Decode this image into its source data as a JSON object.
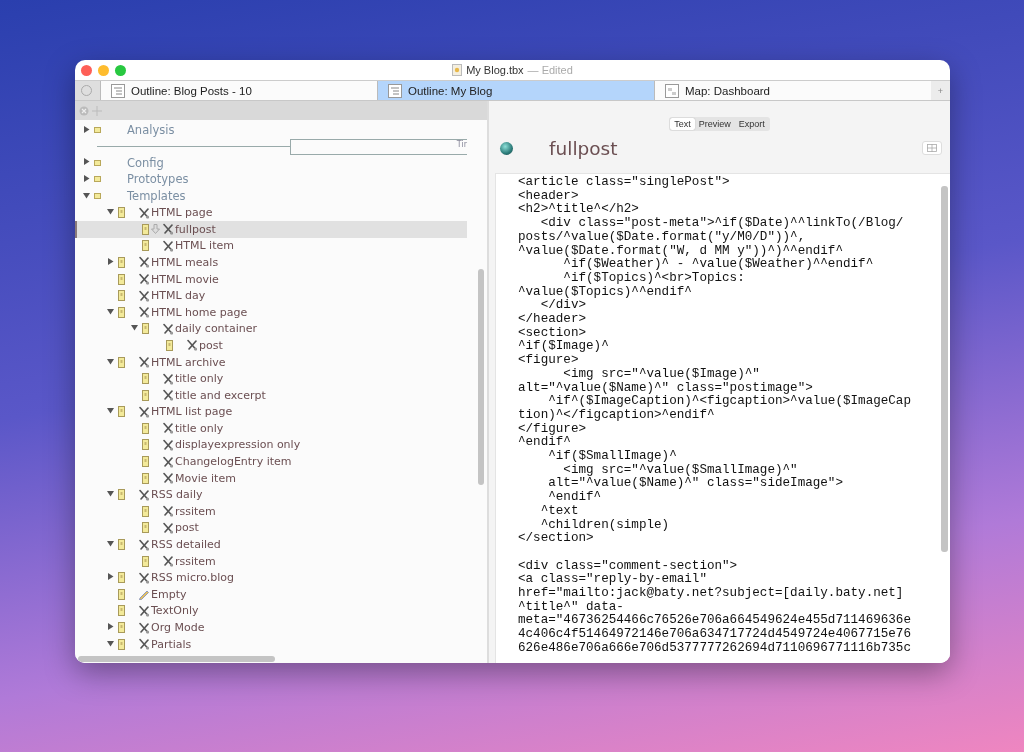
{
  "window": {
    "title": "My Blog.tbx",
    "status": "— Edited"
  },
  "tabs": [
    {
      "label": "Outline: Blog Posts - 10",
      "kind": "outline",
      "selected": false
    },
    {
      "label": "Outline: My Blog",
      "kind": "outline",
      "selected": true
    },
    {
      "label": "Map: Dashboard",
      "kind": "map",
      "selected": false
    }
  ],
  "new_tab_button": "+",
  "outline": {
    "timeline_label": "Tir",
    "items": [
      {
        "name": "Analysis",
        "kind": "container",
        "expanded": false,
        "selected": false
      },
      {
        "name": "Config",
        "kind": "container",
        "expanded": false,
        "selected": false
      },
      {
        "name": "Prototypes",
        "kind": "container",
        "expanded": false,
        "selected": false
      },
      {
        "name": "Templates",
        "kind": "container",
        "expanded": true,
        "selected": false,
        "children": [
          {
            "name": "HTML page",
            "kind": "template",
            "expanded": true,
            "selected": false,
            "children": [
              {
                "name": "fullpost",
                "kind": "template",
                "selected": true
              },
              {
                "name": "HTML item",
                "kind": "template",
                "selected": false
              }
            ]
          },
          {
            "name": "HTML meals",
            "kind": "template",
            "expanded": false,
            "selected": false
          },
          {
            "name": "HTML movie",
            "kind": "template",
            "selected": false
          },
          {
            "name": "HTML day",
            "kind": "template",
            "selected": false
          },
          {
            "name": "HTML home page",
            "kind": "template",
            "expanded": true,
            "selected": false,
            "children": [
              {
                "name": "daily container",
                "kind": "template",
                "expanded": true,
                "selected": false,
                "children": [
                  {
                    "name": "post",
                    "kind": "template",
                    "selected": false
                  }
                ]
              }
            ]
          },
          {
            "name": "HTML archive",
            "kind": "template",
            "expanded": true,
            "selected": false,
            "children": [
              {
                "name": "title only",
                "kind": "template",
                "selected": false
              },
              {
                "name": "title and excerpt",
                "kind": "template",
                "selected": false
              }
            ]
          },
          {
            "name": "HTML list page",
            "kind": "template",
            "expanded": true,
            "selected": false,
            "children": [
              {
                "name": "title only",
                "kind": "template",
                "selected": false
              },
              {
                "name": "displayexpression only",
                "kind": "template",
                "selected": false
              },
              {
                "name": "ChangelogEntry item",
                "kind": "template",
                "selected": false
              },
              {
                "name": "Movie item",
                "kind": "template",
                "selected": false
              }
            ]
          },
          {
            "name": "RSS daily",
            "kind": "template",
            "expanded": true,
            "selected": false,
            "children": [
              {
                "name": "rssitem",
                "kind": "template",
                "selected": false
              },
              {
                "name": "post",
                "kind": "template",
                "selected": false
              }
            ]
          },
          {
            "name": "RSS detailed",
            "kind": "template",
            "expanded": true,
            "selected": false,
            "children": [
              {
                "name": "rssitem",
                "kind": "template",
                "selected": false
              }
            ]
          },
          {
            "name": "RSS micro.blog",
            "kind": "template",
            "expanded": false,
            "selected": false
          },
          {
            "name": "Empty",
            "kind": "note",
            "selected": false
          },
          {
            "name": "TextOnly",
            "kind": "template",
            "selected": false
          },
          {
            "name": "Org Mode",
            "kind": "template",
            "expanded": false,
            "selected": false
          },
          {
            "name": "Partials",
            "kind": "template",
            "expanded": true,
            "selected": false
          }
        ]
      }
    ]
  },
  "editor": {
    "view_tabs": [
      {
        "label": "Text",
        "selected": true
      },
      {
        "label": "Preview",
        "selected": false
      },
      {
        "label": "Export",
        "selected": false
      }
    ],
    "note_title": "fullpost",
    "code_blocks": [
      [
        "<article class=\"singlePost\">",
        "<header>",
        "<h2>^title^</h2>",
        "   <div class=\"post-meta\">^if($Date)^^linkTo(/Blog/",
        "posts/^value($Date.format(\"y/M0/D\"))^,",
        "^value($Date.format(\"W, d MM y\"))^)^^endif^",
        "      ^if($Weather)^ - ^value($Weather)^^endif^",
        "      ^if($Topics)^<br>Topics:",
        "^value($Topics)^^endif^",
        "   </div>",
        "</header>",
        "<section>",
        "^if($Image)^",
        "<figure>",
        "      <img src=\"^value($Image)^\"",
        "alt=\"^value($Name)^\" class=\"postimage\">",
        "    ^if^($ImageCaption)^<figcaption>^value($ImageCap",
        "tion)^</figcaption>^endif^",
        "</figure>",
        "^endif^",
        "    ^if($SmallImage)^",
        "      <img src=\"^value($SmallImage)^\"",
        "    alt=\"^value($Name)^\" class=\"sideImage\">",
        "    ^endif^",
        "   ^text",
        "   ^children(simple)",
        "</section>"
      ],
      [
        "<div class=\"comment-section\">",
        "<a class=\"reply-by-email\"",
        "href=\"mailto:jack@baty.net?subject=[daily.baty.net]",
        "^title^\" data-",
        "meta=\"46736254466c76526e706a664549624e455d711469636e",
        "4c406c4f51464972146e706a634717724d4549724e4067715e76",
        "626e486e706a666e706d5377777262694d7110696771116b735c"
      ]
    ]
  }
}
